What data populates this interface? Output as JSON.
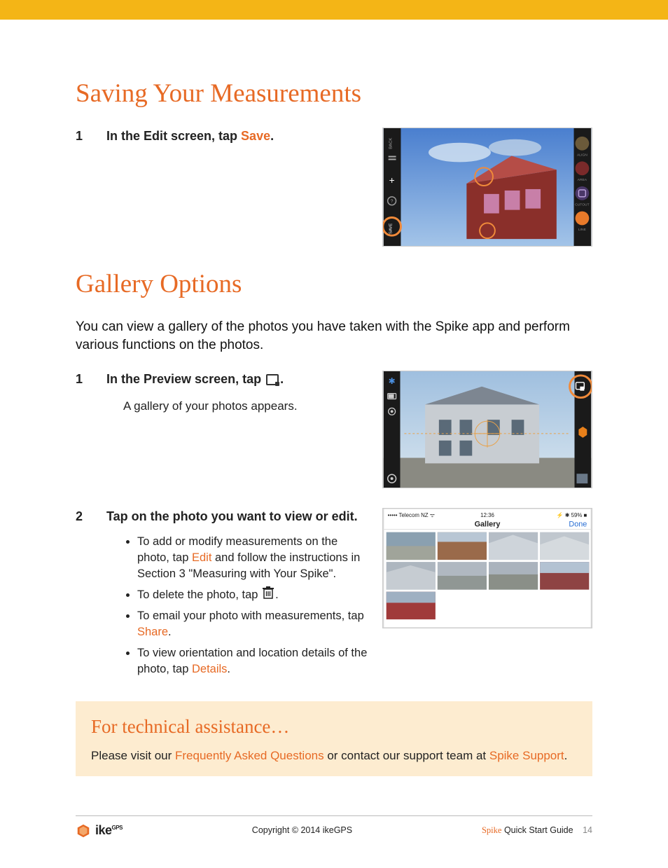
{
  "section1_title": "Saving Your Measurements",
  "section1_steps": [
    {
      "num": "1",
      "title_prefix": "In the Edit screen, tap ",
      "title_accent": "Save",
      "title_suffix": "."
    }
  ],
  "section2_title": "Gallery Options",
  "section2_intro": "You can view a gallery of the photos you have taken with the Spike app and perform various functions on the photos.",
  "section2_steps": [
    {
      "num": "1",
      "title_prefix": "In the Preview screen, tap ",
      "title_suffix": ".",
      "sub": "A gallery of your photos appears."
    },
    {
      "num": "2",
      "title": "Tap on the photo you want to view or edit.",
      "bullets": [
        {
          "pre": "To add or modify measurements on the photo, tap ",
          "accent": "Edit",
          "post": " and follow the instructions in Section 3 \"Measuring with Your Spike\"."
        },
        {
          "pre": "To delete the photo, tap ",
          "icon": "trash",
          "post": "."
        },
        {
          "pre": "To email your photo with measurements, tap ",
          "accent": "Share",
          "post": "."
        },
        {
          "pre": "To view orientation and location details of the photo, tap ",
          "accent": "Details",
          "post": "."
        }
      ]
    }
  ],
  "techbox": {
    "title": "For technical assistance…",
    "text_pre": "Please visit our ",
    "link1": "Frequently Asked Questions",
    "text_mid": " or contact our support team at ",
    "link2": "Spike Support",
    "text_end": "."
  },
  "footer": {
    "logo_text": "ike",
    "logo_sup": "GPS",
    "copyright": "Copyright © 2014 ikeGPS",
    "doc_brand": "Spike",
    "doc_title": "Quick Start Guide",
    "page": "14"
  },
  "gallery_screenshot": {
    "carrier": "••••• Telecom NZ",
    "time": "12:36",
    "battery": "59%",
    "header": "Gallery",
    "done": "Done"
  }
}
